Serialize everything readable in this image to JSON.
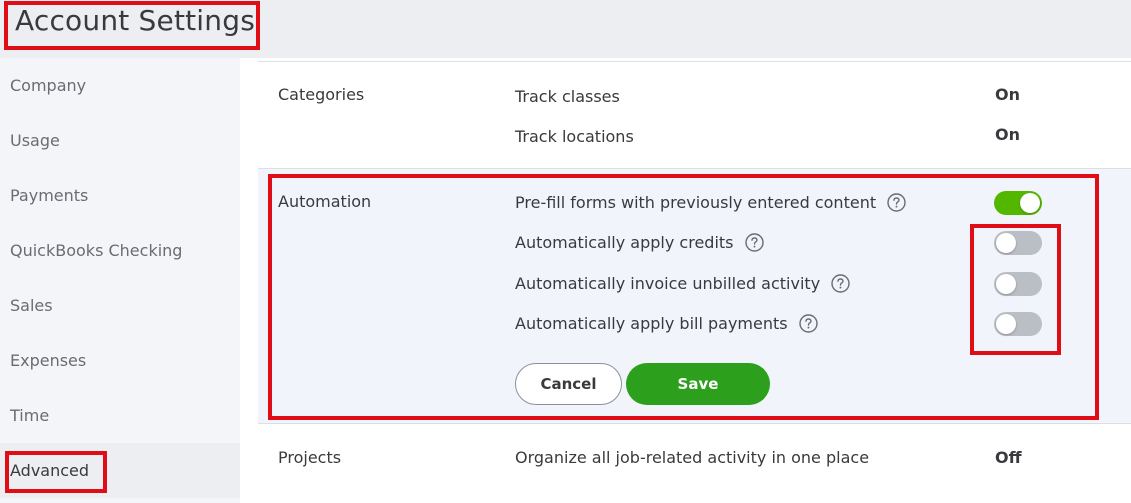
{
  "header": {
    "title": "Account Settings"
  },
  "sidebar": {
    "items": [
      {
        "label": "Company"
      },
      {
        "label": "Usage"
      },
      {
        "label": "Payments"
      },
      {
        "label": "QuickBooks Checking"
      },
      {
        "label": "Sales"
      },
      {
        "label": "Expenses"
      },
      {
        "label": "Time"
      },
      {
        "label": "Advanced"
      }
    ]
  },
  "categories": {
    "label": "Categories",
    "settings": [
      {
        "label": "Track classes",
        "value": "On"
      },
      {
        "label": "Track locations",
        "value": "On"
      }
    ]
  },
  "automation": {
    "label": "Automation",
    "settings": [
      {
        "label": "Pre-fill forms with previously entered content",
        "toggle": "on"
      },
      {
        "label": "Automatically apply credits",
        "toggle": "off"
      },
      {
        "label": "Automatically invoice unbilled activity",
        "toggle": "off"
      },
      {
        "label": "Automatically apply bill payments",
        "toggle": "off"
      }
    ],
    "cancel_label": "Cancel",
    "save_label": "Save"
  },
  "projects": {
    "label": "Projects",
    "setting_label": "Organize all job-related activity in one place",
    "value": "Off"
  },
  "colors": {
    "toggle_on": "#53b700",
    "toggle_off": "#babec5",
    "save_button": "#2ca01c",
    "highlight": "#e00d16"
  }
}
